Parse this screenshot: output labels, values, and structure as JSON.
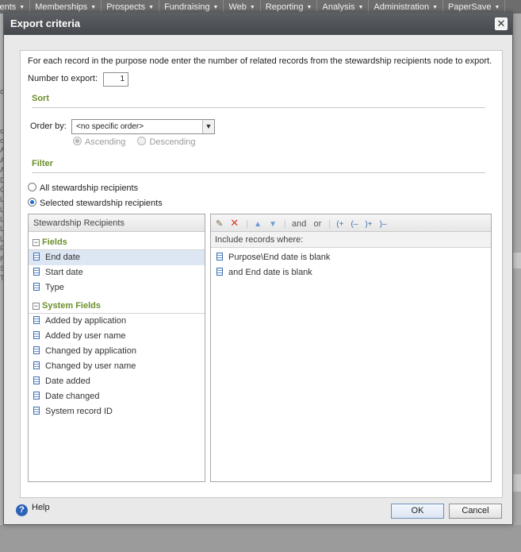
{
  "background": {
    "nav_items": [
      {
        "label": "vents"
      },
      {
        "label": "Memberships"
      },
      {
        "label": "Prospects"
      },
      {
        "label": "Fundraising"
      },
      {
        "label": "Web"
      },
      {
        "label": "Reporting"
      },
      {
        "label": "Analysis"
      },
      {
        "label": "Administration"
      },
      {
        "label": "PaperSave"
      }
    ],
    "left_letters": [
      "c",
      "",
      "",
      "",
      "c",
      "c",
      "A",
      "A",
      "A",
      "D",
      "G",
      "L",
      "L",
      "L",
      "L",
      "L",
      "P",
      "R",
      "S",
      "T"
    ]
  },
  "dialog": {
    "title": "Export criteria",
    "close_symbol": "✕",
    "intro": "For each record in the purpose node enter the number of related records from the stewardship recipients node to export.",
    "number_label": "Number to export:",
    "number_value": "1",
    "sort": {
      "header": "Sort",
      "order_by_label": "Order by:",
      "order_by_value": "<no specific order>",
      "ascending": "Ascending",
      "descending": "Descending"
    },
    "filter": {
      "header": "Filter",
      "option_all": "All stewardship recipients",
      "option_selected": "Selected stewardship recipients"
    },
    "fields_panel": {
      "header": "Stewardship Recipients",
      "groups": [
        {
          "label": "Fields",
          "items": [
            "End date",
            "Start date",
            "Type"
          ]
        },
        {
          "label": "System Fields",
          "items": [
            "Added by application",
            "Added by user name",
            "Changed by application",
            "Changed by user name",
            "Date added",
            "Date changed",
            "System record ID"
          ]
        }
      ]
    },
    "criteria_panel": {
      "toolbar": {
        "and_label": "and",
        "or_label": "or",
        "open_and": "(+",
        "open_not": "(–",
        "close_and": ")+",
        "close_not": ")–"
      },
      "header": "Include records where:",
      "items": [
        "Purpose\\End date is blank",
        "and End date is blank"
      ]
    },
    "footer": {
      "help": "Help",
      "ok": "OK",
      "cancel": "Cancel"
    }
  },
  "colors": {
    "section_header": "#6a8f2a",
    "titlebar": "#45484c",
    "selected_row": "#dde7f3"
  }
}
